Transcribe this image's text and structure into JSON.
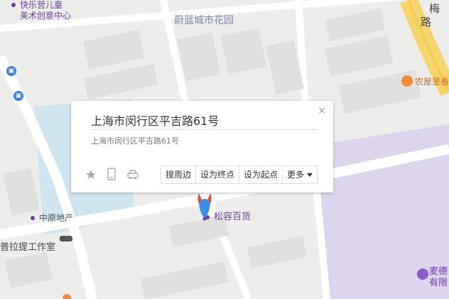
{
  "map": {
    "labels": {
      "kindergarten_line1": "快乐营儿童",
      "kindergarten_line2": "美术创意中心",
      "garden": "蔚蓝城市花园",
      "road_vertical_1": "梅",
      "road_vertical_2": "路",
      "restaurant": "农屋里香",
      "realestate": "中原地产",
      "studio": "普拉提工作室",
      "store": "松容百货",
      "company_line1": "麦德",
      "company_line2": "有限"
    }
  },
  "popup": {
    "title": "上海市闵行区平吉路61号",
    "address": "上海市闵行区平吉路61号",
    "close": "×",
    "actions": {
      "nearby": "搜周边",
      "set_end": "设为终点",
      "set_start": "设为起点",
      "more": "更多"
    },
    "colors": {
      "accent": "#3b7ce0",
      "marker": "#e24a3b"
    }
  }
}
